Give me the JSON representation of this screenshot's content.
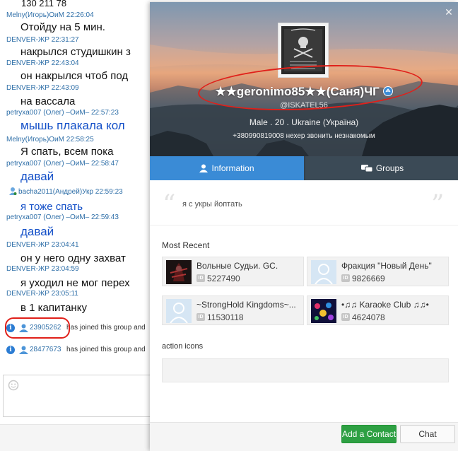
{
  "chat": {
    "top_line": "130   211  78",
    "messages": [
      {
        "sender": "Melny(Игорь)ОиМ 22:26:04",
        "text": "Отойду на 5 мин.",
        "style": "normal"
      },
      {
        "sender": "DENVER-ЖР 22:31:27",
        "text": "накрылся студишкин з",
        "style": "normal"
      },
      {
        "sender": "DENVER-ЖР 22:43:04",
        "text": "он накрылся чтоб под",
        "style": "normal"
      },
      {
        "sender": "DENVER-ЖР 22:43:09",
        "text": "на вассала",
        "style": "normal"
      },
      {
        "sender": "petryxa007 (Олег) –ОиМ– 22:57:23",
        "text": "мышь плакала кол",
        "style": "blue"
      },
      {
        "sender": "Melny(Игорь)ОиМ 22:58:25",
        "text": "Я спать, всем пока",
        "style": "normal"
      },
      {
        "sender": "petryxa007 (Олег) –ОиМ– 22:58:47",
        "text": "давай",
        "style": "blue"
      },
      {
        "sender": "bacha2011(Андрей)Укр 22:59:23",
        "text": "я тоже спать",
        "style": "blue"
      },
      {
        "sender": "petryxa007 (Олег) –ОиМ– 22:59:43",
        "text": "давай",
        "style": "blue"
      },
      {
        "sender": "DENVER-ЖР 23:04:41",
        "text": "он у него одну захват",
        "style": "normal"
      },
      {
        "sender": "DENVER-ЖР 23:04:59",
        "text": "я уходил не мог перех",
        "style": "normal"
      },
      {
        "sender": "DENVER-ЖР 23:05:11",
        "text": "в 1 капитанку",
        "style": "normal"
      }
    ],
    "system": [
      {
        "id": "23905262",
        "text": "has joined this group and"
      },
      {
        "id": "28477673",
        "text": "has joined this group and"
      }
    ]
  },
  "profile": {
    "close_label": "✕",
    "nickname": "★★geronimo85★★(Саня)ЧГ",
    "handle": "@ISKATEL56",
    "meta": "Male  .  20  .  Ukraine (Україна)",
    "status": "+380990819008 нехер звонить незнакомым",
    "tabs": {
      "information": "Information",
      "groups": "Groups"
    },
    "about": "я с укры йоптать",
    "most_recent_title": "Most Recent",
    "groups": [
      {
        "name": "Вольные Судьи. GC.",
        "id": "5227490",
        "thumb": "dark-red"
      },
      {
        "name": "Фракция \"Новый День\"",
        "id": "9826669",
        "thumb": "default"
      },
      {
        "name": "~StrongHold Kingdoms~...",
        "id": "11530118",
        "thumb": "default"
      },
      {
        "name": "•♫♫ Karaoke Club ♫♫•",
        "id": "4624078",
        "thumb": "karaoke"
      }
    ],
    "action_title": "action icons",
    "buttons": {
      "add_contact": "Add a Contact",
      "chat": "Chat"
    }
  },
  "colors": {
    "accent_tab": "#3a8bd6",
    "tabs_bg": "#33414e",
    "add_button": "#2ea043",
    "sender_blue": "#2f6fa8",
    "annotation_red": "#e0201a"
  }
}
